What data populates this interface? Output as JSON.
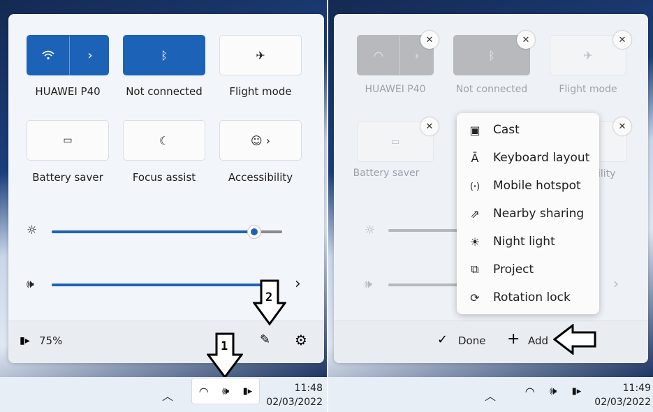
{
  "left": {
    "tiles": [
      {
        "label": "HUAWEI P40",
        "icon": "wifi-icon",
        "state": "on"
      },
      {
        "label": "Not connected",
        "icon": "bluetooth-icon",
        "state": "on"
      },
      {
        "label": "Flight mode",
        "icon": "airplane-icon",
        "state": "off"
      },
      {
        "label": "Battery saver",
        "icon": "battery-saver-icon",
        "state": "off"
      },
      {
        "label": "Focus assist",
        "icon": "moon-icon",
        "state": "off"
      },
      {
        "label": "Accessibility",
        "icon": "accessibility-icon",
        "state": "off"
      }
    ],
    "brightness": 0.88,
    "volume": 1.0,
    "battery_text": "75%",
    "annotations": {
      "label_1": "1",
      "label_2": "2"
    },
    "clock": {
      "time": "11:48",
      "date": "02/03/2022"
    }
  },
  "right": {
    "tiles": [
      {
        "label": "HUAWEI P40"
      },
      {
        "label": "Not connected"
      },
      {
        "label": "Flight mode"
      },
      {
        "label": "Battery saver"
      },
      {
        "label": "ility"
      }
    ],
    "menu": [
      {
        "label": "Cast",
        "icon": "cast-icon"
      },
      {
        "label": "Keyboard layout",
        "icon": "keyboard-layout-icon"
      },
      {
        "label": "Mobile hotspot",
        "icon": "hotspot-icon"
      },
      {
        "label": "Nearby sharing",
        "icon": "nearby-sharing-icon"
      },
      {
        "label": "Night light",
        "icon": "night-light-icon"
      },
      {
        "label": "Project",
        "icon": "project-icon"
      },
      {
        "label": "Rotation lock",
        "icon": "rotation-lock-icon"
      }
    ],
    "done_label": "Done",
    "add_label": "Add",
    "clock": {
      "time": "11:49",
      "date": "02/03/2022"
    }
  },
  "colors": {
    "accent": "#1c63b8",
    "panel": "#f2f5f9",
    "disabled_tile": "#b7b9bc"
  }
}
